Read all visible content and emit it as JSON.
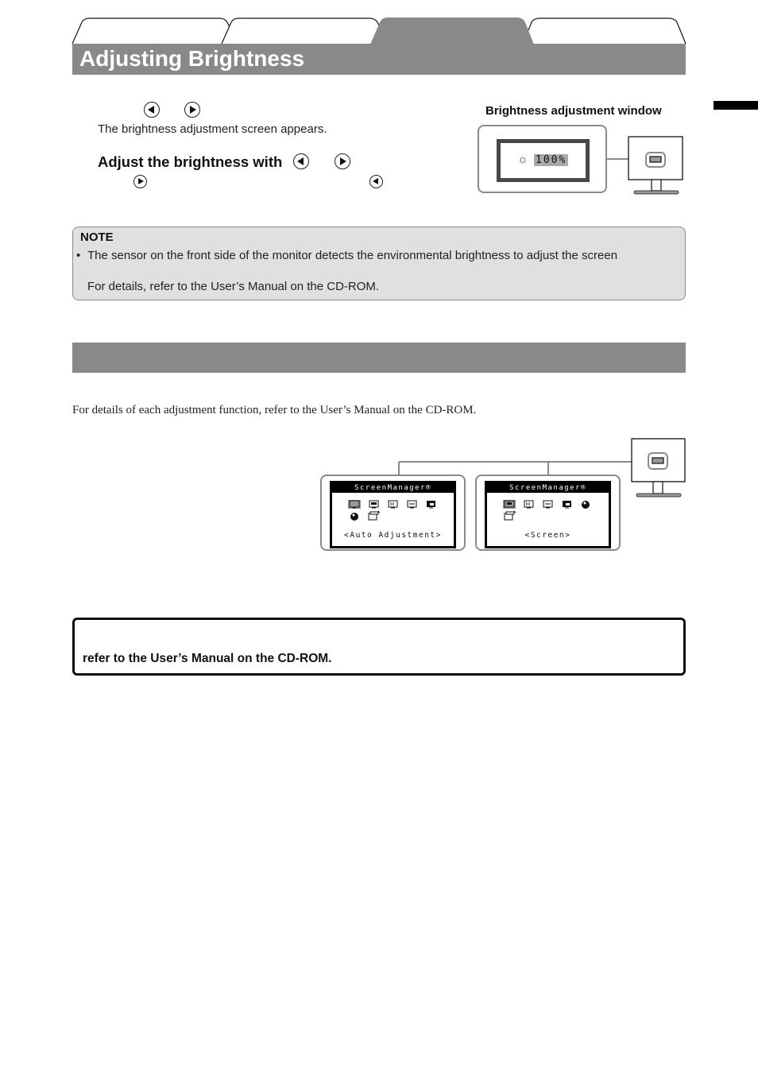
{
  "header": {
    "tabs": [
      "",
      "",
      "",
      ""
    ],
    "active_tab_index": 2,
    "title": "Adjusting Brightness"
  },
  "brightness_section": {
    "step1_buttons": [
      "left-button-icon",
      "right-button-icon"
    ],
    "step1_text": "The brightness adjustment screen appears.",
    "step2_heading": "Adjust the brightness with",
    "step2_buttons": [
      "left-button-icon",
      "right-button-icon"
    ],
    "step2_sub_buttons": [
      "right-button-icon",
      "left-button-icon"
    ],
    "window_label": "Brightness adjustment window",
    "osd_icon": "sun-icon",
    "osd_value": "100%"
  },
  "note": {
    "title": "NOTE",
    "bullet": "•",
    "line1": "The sensor on the front side of the monitor detects the environmental brightness to adjust the screen",
    "line2": "For details, refer to the User’s Manual on the CD-ROM."
  },
  "section2": {
    "bar_title": "",
    "intro": "For details of each adjustment function, refer to the User’s Manual on the CD-ROM.",
    "menus": [
      {
        "header": "ScreenManager®",
        "caption": "<Auto Adjustment>",
        "icons": [
          "auto-adjustment-icon",
          "screen-icon",
          "color-icon",
          "power-save-icon",
          "monitor-settings-icon",
          "language-icon",
          "information-icon"
        ],
        "selected_index": 0
      },
      {
        "header": "ScreenManager®",
        "caption": "<Screen>",
        "icons": [
          "screen-icon",
          "color-icon",
          "power-save-icon",
          "monitor-settings-icon",
          "language-icon",
          "information-icon"
        ],
        "selected_index": 0
      }
    ]
  },
  "important": {
    "text": "refer to the User’s Manual on the CD-ROM."
  },
  "colors": {
    "header_gray": "#898989",
    "note_bg": "#e0e0e0",
    "osd_border": "#4a4646",
    "osd_highlight": "#a9a9a9"
  }
}
